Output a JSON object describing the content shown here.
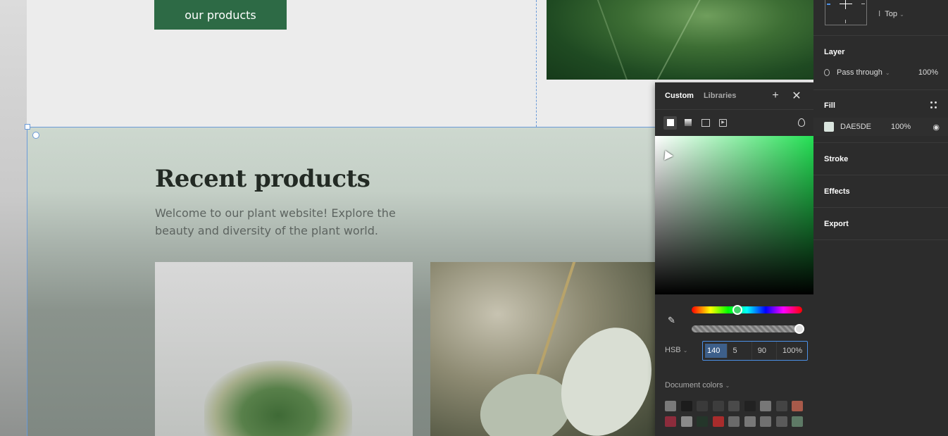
{
  "canvas": {
    "cta_label": "our products",
    "section": {
      "title": "Recent products",
      "description": "Welcome to our plant website! Explore the beauty and diversity of the plant world."
    }
  },
  "color_picker": {
    "tabs": [
      "Custom",
      "Libraries"
    ],
    "mode": "HSB",
    "values": {
      "h": "140",
      "s": "5",
      "b": "90",
      "alpha": "100%"
    },
    "hue_level": 0.38,
    "alpha_level": 1.0,
    "document_colors_label": "Document colors",
    "document_colors": [
      "#7a7a7a",
      "#1c1c1c",
      "#3a3a3a",
      "#3d3d3d",
      "#4a4a4a",
      "#222222",
      "#777777",
      "#444444",
      "#a85a4a",
      "#8c2c3c",
      "#8a8a8a",
      "#24362a",
      "#a82c2c",
      "#6a6a6a",
      "#777777",
      "#707070",
      "#5a5a5a",
      "#5e7a66"
    ]
  },
  "right_panel": {
    "constraint_vertical": "Top",
    "layer": {
      "label": "Layer",
      "blend_mode": "Pass through",
      "opacity": "100%"
    },
    "fill": {
      "label": "Fill",
      "hex": "DAE5DE",
      "opacity": "100%",
      "color": "#DAE5DE"
    },
    "sections": {
      "stroke": "Stroke",
      "effects": "Effects",
      "export": "Export"
    }
  }
}
